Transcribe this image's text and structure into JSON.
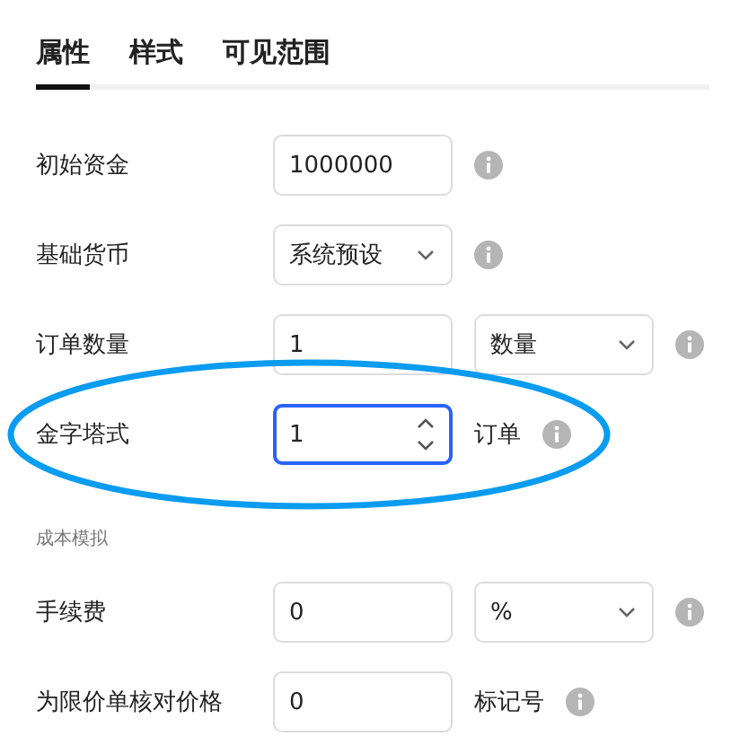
{
  "tabs": [
    {
      "label": "属性",
      "selected": true
    },
    {
      "label": "样式",
      "selected": false
    },
    {
      "label": "可见范围",
      "selected": false
    }
  ],
  "sections": [
    {
      "rows": [
        {
          "label": "初始资金",
          "field": {
            "kind": "input",
            "value": "1000000"
          },
          "highlighted": false
        },
        {
          "label": "基础货币",
          "field": {
            "kind": "select",
            "value": "系统预设"
          },
          "highlighted": false
        },
        {
          "label": "订单数量",
          "field": {
            "kind": "input",
            "value": "1"
          },
          "unit_select": {
            "value": "数量"
          },
          "highlighted": false
        },
        {
          "label": "金字塔式",
          "field": {
            "kind": "spinner",
            "value": "1",
            "focused": true
          },
          "suffix": "订单",
          "highlighted": true
        }
      ]
    },
    {
      "title": "成本模拟",
      "rows": [
        {
          "label": "手续费",
          "field": {
            "kind": "input",
            "value": "0"
          },
          "unit_select": {
            "value": "%"
          },
          "highlighted": false
        },
        {
          "label": "为限价单核对价格",
          "field": {
            "kind": "input",
            "value": "0"
          },
          "suffix": "标记号",
          "highlighted": false
        }
      ]
    }
  ]
}
